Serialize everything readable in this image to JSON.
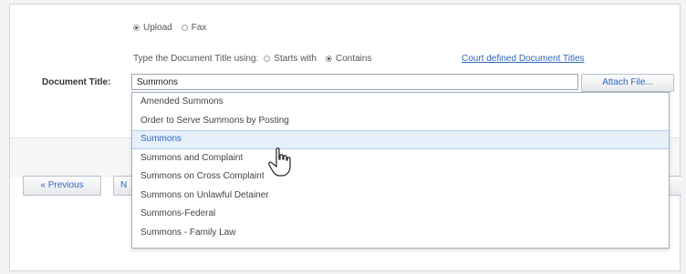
{
  "submission": {
    "options": [
      {
        "label": "Upload",
        "checked": true
      },
      {
        "label": "Fax",
        "checked": false
      }
    ]
  },
  "search_mode": {
    "prompt": "Type the Document Title using:",
    "options": [
      {
        "label": "Starts with",
        "checked": false
      },
      {
        "label": "Contains",
        "checked": true
      }
    ]
  },
  "court_titles_link": "Court defined Document Titles",
  "document_title": {
    "label": "Document Title:",
    "value": "Summons"
  },
  "attach_button": "Attach File...",
  "dropdown": {
    "items": [
      "Amended Summons",
      "Order to Serve Summons by Posting",
      "Summons",
      "Summons and Complaint",
      "Summons on Cross Complaint",
      "Summons on Unlawful Detainer",
      "Summons-Federal",
      "Summons - Family Law"
    ],
    "selected_index": 2
  },
  "nav": {
    "previous": "« Previous",
    "next": "N"
  },
  "colors": {
    "link": "#2f66c1",
    "highlight": "#e6f0fb"
  }
}
